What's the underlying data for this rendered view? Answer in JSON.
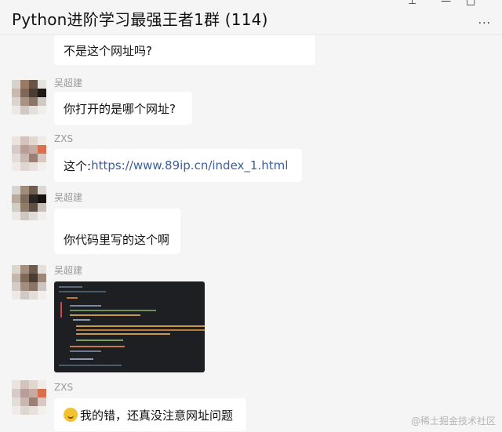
{
  "window": {
    "title": "Python进阶学习最强王者1群 (114)",
    "pin_icon": "pin-icon",
    "minimize_icon": "minimize-icon",
    "maximize_icon": "maximize-icon",
    "more_label": "···"
  },
  "messages": [
    {
      "sender": "",
      "text": "不是这个网址吗?"
    },
    {
      "sender": "吴超建",
      "text": "你打开的是哪个网址?"
    },
    {
      "sender": "ZXS",
      "prefix": "这个:",
      "link": "https://www.89ip.cn/index_1.html"
    },
    {
      "sender": "吴超建",
      "text": "你代码里写的这个啊"
    },
    {
      "sender": "吴超建",
      "image": "code-screenshot"
    },
    {
      "sender": "ZXS",
      "emoji": "sweat-smile-emoji",
      "text": "我的错，还真没注意网址问题"
    }
  ],
  "watermark": "@稀土掘金技术社区",
  "colors": {
    "background": "#f5f5f5",
    "bubble": "#ffffff",
    "link": "#3a5f9d",
    "sender": "#9a9a9a"
  }
}
